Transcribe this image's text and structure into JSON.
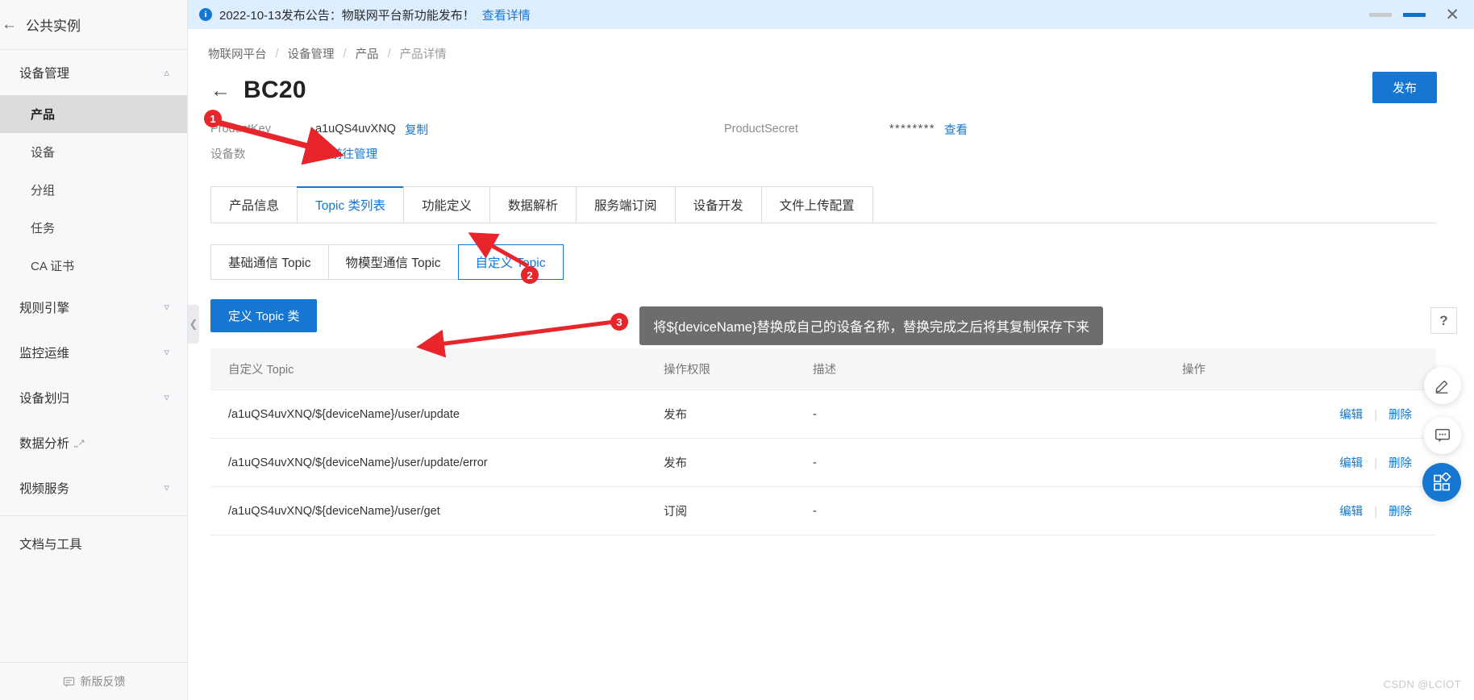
{
  "sidebar": {
    "instance": {
      "label": "公共实例",
      "back_icon": "arrow-left-icon"
    },
    "group_device": {
      "label": "设备管理",
      "chevron": "chevron-up-icon"
    },
    "items": [
      {
        "label": "产品",
        "active": true
      },
      {
        "label": "设备",
        "active": false
      },
      {
        "label": "分组",
        "active": false
      },
      {
        "label": "任务",
        "active": false
      },
      {
        "label": "CA 证书",
        "active": false
      }
    ],
    "groups": [
      {
        "label": "规则引擎",
        "chevron": "chevron-down-icon",
        "external": false
      },
      {
        "label": "监控运维",
        "chevron": "chevron-down-icon",
        "external": false
      },
      {
        "label": "设备划归",
        "chevron": "chevron-down-icon",
        "external": false
      },
      {
        "label": "数据分析",
        "chevron": "",
        "external": true
      },
      {
        "label": "视频服务",
        "chevron": "chevron-down-icon",
        "external": false
      }
    ],
    "docs": {
      "label": "文档与工具"
    },
    "footer": {
      "label": "新版反馈",
      "icon": "feedback-icon"
    },
    "collapse_handle": {
      "icon": "chevron-left-icon"
    }
  },
  "notice": {
    "icon": "info-circle-icon",
    "text": "2022-10-13发布公告：物联网平台新功能发布！",
    "link": "查看详情",
    "close_icon": "close-icon",
    "pagers": [
      {
        "active": false
      },
      {
        "active": true
      }
    ]
  },
  "breadcrumb": [
    {
      "label": "物联网平台",
      "last": false
    },
    {
      "label": "设备管理",
      "last": false
    },
    {
      "label": "产品",
      "last": false
    },
    {
      "label": "产品详情",
      "last": true
    }
  ],
  "breadcrumb_sep": "/",
  "header": {
    "back_icon": "arrow-left-icon",
    "title": "BC20",
    "publish_button": "发布"
  },
  "meta": {
    "product_key_label": "ProductKey",
    "product_key_value": "a1uQS4uvXNQ",
    "copy_link": "复制",
    "device_count_label": "设备数",
    "device_count_value": "1",
    "manage_link": "前往管理",
    "product_secret_label": "ProductSecret",
    "product_secret_value": "********",
    "view_link": "查看"
  },
  "tabs": [
    {
      "label": "产品信息",
      "active": false
    },
    {
      "label": "Topic 类列表",
      "active": true
    },
    {
      "label": "功能定义",
      "active": false
    },
    {
      "label": "数据解析",
      "active": false
    },
    {
      "label": "服务端订阅",
      "active": false
    },
    {
      "label": "设备开发",
      "active": false
    },
    {
      "label": "文件上传配置",
      "active": false
    }
  ],
  "subtabs": [
    {
      "label": "基础通信 Topic",
      "active": false
    },
    {
      "label": "物模型通信 Topic",
      "active": false
    },
    {
      "label": "自定义 Topic",
      "active": true
    }
  ],
  "define_button": "定义 Topic 类",
  "table": {
    "headers": [
      "自定义 Topic",
      "操作权限",
      "描述",
      "操作"
    ],
    "rows": [
      {
        "topic": "/a1uQS4uvXNQ/${deviceName}/user/update",
        "perm": "发布",
        "desc": "-",
        "edit": "编辑",
        "delete": "删除"
      },
      {
        "topic": "/a1uQS4uvXNQ/${deviceName}/user/update/error",
        "perm": "发布",
        "desc": "-",
        "edit": "编辑",
        "delete": "删除"
      },
      {
        "topic": "/a1uQS4uvXNQ/${deviceName}/user/get",
        "perm": "订阅",
        "desc": "-",
        "edit": "编辑",
        "delete": "删除"
      }
    ]
  },
  "tooltip": "将${deviceName}替换成自己的设备名称，替换完成之后将其复制保存下来",
  "annotations": {
    "markers": [
      {
        "label": "1"
      },
      {
        "label": "2"
      },
      {
        "label": "3"
      }
    ],
    "color": "#e8252a"
  },
  "floating": {
    "help": {
      "label": "?",
      "icon": "question-mark-icon"
    },
    "pencil": {
      "icon": "pencil-icon"
    },
    "chat": {
      "icon": "chat-bubble-icon"
    },
    "apps": {
      "icon": "apps-grid-icon"
    }
  },
  "watermark": "CSDN @LCIOT",
  "colors": {
    "accent": "#1677d2",
    "marker": "#e8252a",
    "notice_bg": "#dceeff",
    "sidebar_bg": "#f7f8fa"
  }
}
